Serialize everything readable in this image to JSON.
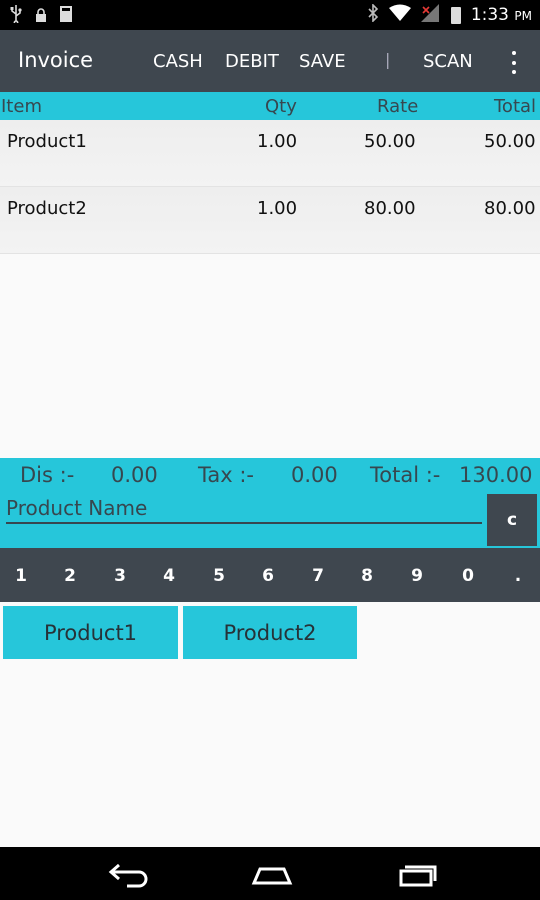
{
  "status_bar": {
    "left_icons": [
      "usb-icon",
      "lock-icon",
      "storage-icon"
    ],
    "right_icons": [
      "bluetooth-icon",
      "wifi-icon",
      "signal-icon",
      "battery-icon"
    ],
    "time": "1:33",
    "ampm": "PM"
  },
  "action_bar": {
    "title": "Invoice",
    "actions": [
      "CASH",
      "DEBIT",
      "SAVE"
    ],
    "separator": "|",
    "scan": "SCAN"
  },
  "table": {
    "headers": [
      "Item",
      "Qty",
      "Rate",
      "Total"
    ],
    "rows": [
      {
        "item": "Product1",
        "qty": "1.00",
        "rate": "50.00",
        "total": "50.00"
      },
      {
        "item": "Product2",
        "qty": "1.00",
        "rate": "80.00",
        "total": "80.00"
      }
    ]
  },
  "summary": {
    "dis_label": "Dis :-",
    "dis_value": "0.00",
    "tax_label": "Tax :-",
    "tax_value": "0.00",
    "total_label": "Total :-",
    "total_value": "130.00"
  },
  "product_input": {
    "placeholder": "Product Name",
    "value": "",
    "clear_label": "c"
  },
  "keypad": [
    "1",
    "2",
    "3",
    "4",
    "5",
    "6",
    "7",
    "8",
    "9",
    "0",
    "."
  ],
  "products": [
    "Product1",
    "Product2"
  ],
  "colors": {
    "accent": "#26c6da",
    "bar": "#3f474f"
  }
}
